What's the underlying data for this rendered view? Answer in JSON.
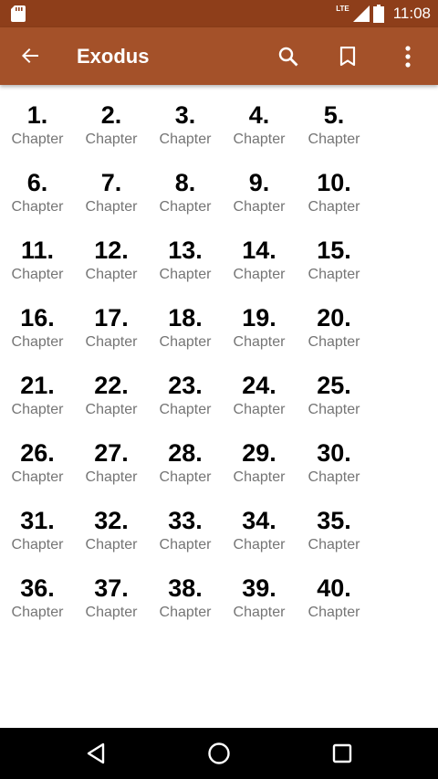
{
  "status_bar": {
    "network": "LTE",
    "time": "11:08",
    "icons": [
      "sd-card-icon",
      "lte-icon",
      "signal-icon",
      "battery-icon"
    ]
  },
  "app_bar": {
    "title": "Exodus",
    "background": "#a45129",
    "status_background": "#8e3e1a",
    "actions": [
      "back-arrow-icon",
      "search-icon",
      "bookmark-icon",
      "more-vert-icon"
    ]
  },
  "chapters": [
    {
      "number": "1.",
      "label": "Chapter"
    },
    {
      "number": "2.",
      "label": "Chapter"
    },
    {
      "number": "3.",
      "label": "Chapter"
    },
    {
      "number": "4.",
      "label": "Chapter"
    },
    {
      "number": "5.",
      "label": "Chapter"
    },
    {
      "number": "6.",
      "label": "Chapter"
    },
    {
      "number": "7.",
      "label": "Chapter"
    },
    {
      "number": "8.",
      "label": "Chapter"
    },
    {
      "number": "9.",
      "label": "Chapter"
    },
    {
      "number": "10.",
      "label": "Chapter"
    },
    {
      "number": "11.",
      "label": "Chapter"
    },
    {
      "number": "12.",
      "label": "Chapter"
    },
    {
      "number": "13.",
      "label": "Chapter"
    },
    {
      "number": "14.",
      "label": "Chapter"
    },
    {
      "number": "15.",
      "label": "Chapter"
    },
    {
      "number": "16.",
      "label": "Chapter"
    },
    {
      "number": "17.",
      "label": "Chapter"
    },
    {
      "number": "18.",
      "label": "Chapter"
    },
    {
      "number": "19.",
      "label": "Chapter"
    },
    {
      "number": "20.",
      "label": "Chapter"
    },
    {
      "number": "21.",
      "label": "Chapter"
    },
    {
      "number": "22.",
      "label": "Chapter"
    },
    {
      "number": "23.",
      "label": "Chapter"
    },
    {
      "number": "24.",
      "label": "Chapter"
    },
    {
      "number": "25.",
      "label": "Chapter"
    },
    {
      "number": "26.",
      "label": "Chapter"
    },
    {
      "number": "27.",
      "label": "Chapter"
    },
    {
      "number": "28.",
      "label": "Chapter"
    },
    {
      "number": "29.",
      "label": "Chapter"
    },
    {
      "number": "30.",
      "label": "Chapter"
    },
    {
      "number": "31.",
      "label": "Chapter"
    },
    {
      "number": "32.",
      "label": "Chapter"
    },
    {
      "number": "33.",
      "label": "Chapter"
    },
    {
      "number": "34.",
      "label": "Chapter"
    },
    {
      "number": "35.",
      "label": "Chapter"
    },
    {
      "number": "36.",
      "label": "Chapter"
    },
    {
      "number": "37.",
      "label": "Chapter"
    },
    {
      "number": "38.",
      "label": "Chapter"
    },
    {
      "number": "39.",
      "label": "Chapter"
    },
    {
      "number": "40.",
      "label": "Chapter"
    }
  ],
  "nav_bar": {
    "buttons": [
      "back-triangle-icon",
      "home-circle-icon",
      "recents-square-icon"
    ]
  }
}
